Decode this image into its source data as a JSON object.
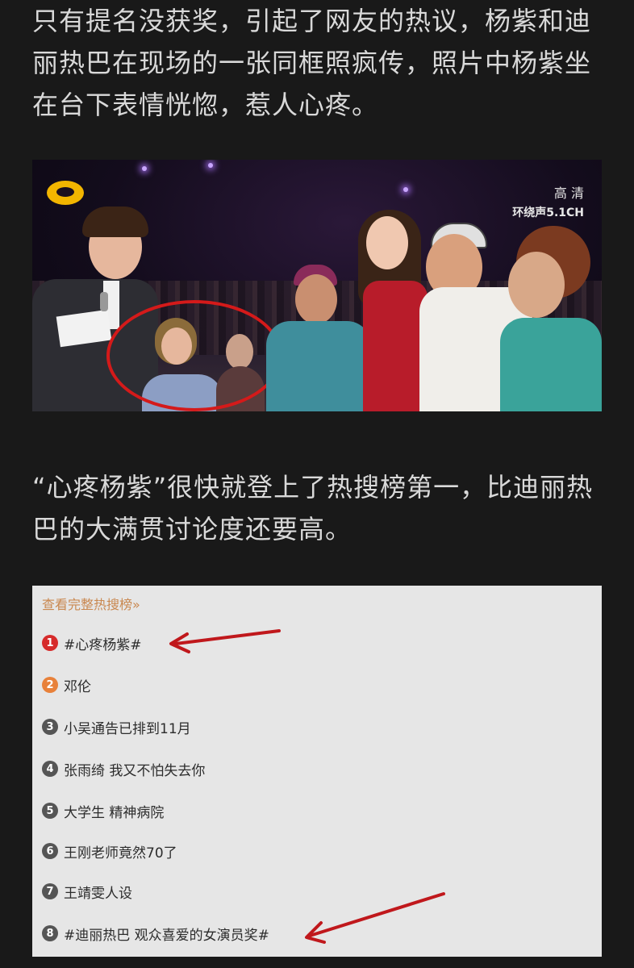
{
  "article": {
    "paragraph1": "只有提名没获奖，引起了网友的热议，杨紫和迪丽热巴在现场的一张同框照疯传，照片中杨紫坐在台下表情恍惚，惹人心疼。",
    "paragraph2": "“心疼杨紫”很快就登上了热搜榜第一，比迪丽热巴的大满贯讨论度还要高。"
  },
  "photo": {
    "hd_label": "高 清",
    "sound_label": "环绕声5.1CH"
  },
  "hot_search": {
    "title": "查看完整热搜榜»",
    "items": [
      {
        "rank": "1",
        "text": "#心疼杨紫#",
        "color": "#d62b2b"
      },
      {
        "rank": "2",
        "text": "邓伦",
        "color": "#e8813a"
      },
      {
        "rank": "3",
        "text": "小吴通告已排到11月",
        "color": "#555555"
      },
      {
        "rank": "4",
        "text": "张雨绮 我又不怕失去你",
        "color": "#555555"
      },
      {
        "rank": "5",
        "text": "大学生 精神病院",
        "color": "#555555"
      },
      {
        "rank": "6",
        "text": "王刚老师竟然70了",
        "color": "#555555"
      },
      {
        "rank": "7",
        "text": "王靖雯人设",
        "color": "#555555"
      },
      {
        "rank": "8",
        "text": "#迪丽热巴 观众喜爱的女演员奖#",
        "color": "#555555"
      }
    ]
  },
  "colors": {
    "background": "#191919",
    "text": "#d9d9d9",
    "annotation_red": "#c0181c"
  }
}
